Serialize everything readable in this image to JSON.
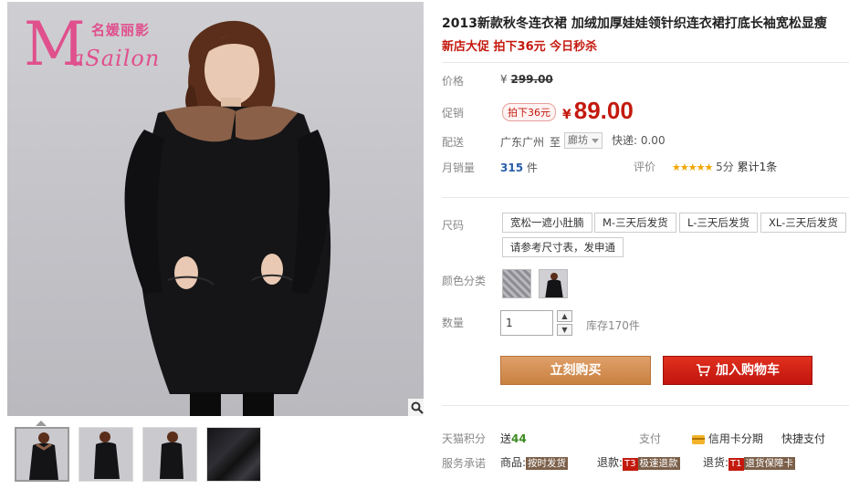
{
  "brand": {
    "logo_letter": "M",
    "logo_chinese": "名媛丽影",
    "logo_name": "aSailon"
  },
  "gallery": {
    "zoom_icon": "magnifier-icon",
    "thumbnails": [
      {
        "name": "front-view",
        "active": true
      },
      {
        "name": "side-view",
        "active": false
      },
      {
        "name": "back-view",
        "active": false
      },
      {
        "name": "fabric-detail",
        "active": false
      }
    ]
  },
  "product": {
    "title": "2013新款秋冬连衣裙 加绒加厚娃娃领针织连衣裙打底长袖宽松显瘦",
    "promo": "新店大促 拍下36元 今日秒杀"
  },
  "price": {
    "label": "价格",
    "currency": "¥",
    "original": "299.00"
  },
  "promotion": {
    "label": "促销",
    "tag": "拍下36元",
    "currency": "¥",
    "price": "89.00"
  },
  "delivery": {
    "label": "配送",
    "from": "广东广州",
    "to_word": "至",
    "city": "廊坊",
    "fee": "快递: 0.00"
  },
  "sales": {
    "label": "月销量",
    "count": "315",
    "unit": "件",
    "rating_label": "评价",
    "stars": "★★★★★",
    "score": "5分",
    "reviews": "累计1条"
  },
  "size": {
    "label": "尺码",
    "options": [
      "宽松一遮小肚腩",
      "M-三天后发货",
      "L-三天后发货",
      "XL-三天后发货",
      "请参考尺寸表，发申通"
    ]
  },
  "color": {
    "label": "颜色分类",
    "options": [
      "gray-pattern",
      "black-dress"
    ]
  },
  "quantity": {
    "label": "数量",
    "value": "1",
    "up": "▲",
    "down": "▼",
    "stock": "库存170件"
  },
  "actions": {
    "buy": "立刻购买",
    "cart": "加入购物车",
    "cart_icon": "cart-icon"
  },
  "footer": {
    "points_label": "天猫积分",
    "points_prefix": "送",
    "points_value": "44",
    "pay_label": "支付",
    "credit": "信用卡分期",
    "quick_pay": "快捷支付",
    "service_label": "服务承诺",
    "goods_label": "商品:",
    "goods_badge": "按时发货",
    "refund_label": "退款:",
    "refund_code": "T3",
    "refund_badge": "极速退款",
    "return_label": "退货:",
    "return_code": "T1",
    "return_badge": "退货保障卡"
  }
}
